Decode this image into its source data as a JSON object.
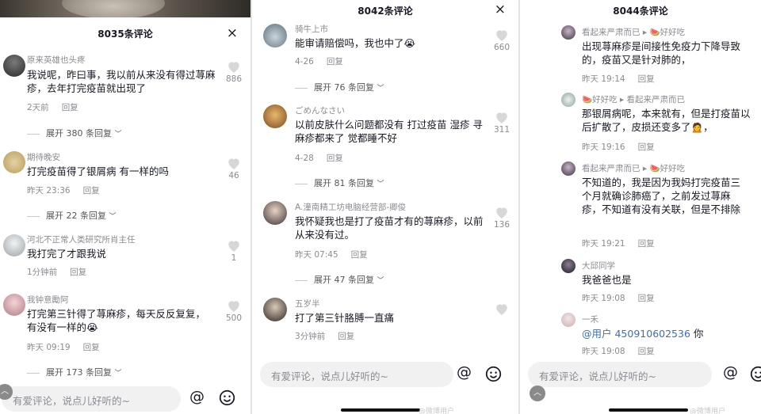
{
  "panels": [
    {
      "title": "8035条评论",
      "close": "×",
      "comments": [
        {
          "user": "原来英雄也头疼",
          "text": "我说呢，昨曰事，我以前从来没有得过荨麻疹，去年打完疫苗就出现了",
          "time": "2天前",
          "reply": "回复",
          "likes": "886",
          "expand": "展开 380 条回复"
        },
        {
          "user": "期待晚安",
          "text": "打完疫苗得了银屑病 有一样的吗",
          "time": "昨天 23:36",
          "reply": "回复",
          "likes": "46",
          "expand": "展开 22 条回复"
        },
        {
          "user": "河北不正常人类研究所肖主任",
          "text": "我打完了才跟我说",
          "time": "1分钟前",
          "reply": "回复",
          "likes": "1",
          "expand": ""
        },
        {
          "user": "我钟意勵阿",
          "text": "打完第三针得了荨麻疹，每天反反复复，有没有一样的😭",
          "time": "昨天 09:19",
          "reply": "回复",
          "likes": "500",
          "expand": "展开 173 条回复"
        }
      ],
      "input_placeholder": "有爱评论，说点儿好听的~"
    },
    {
      "title": "8042条评论",
      "close": "×",
      "comments": [
        {
          "user": "骑牛上市",
          "text": "能审请赔偿吗，我也中了😭",
          "time": "4-26",
          "reply": "回复",
          "likes": "660",
          "expand": "展开 76 条回复"
        },
        {
          "user": "ごめんなさい",
          "text": "以前皮肤什么问题都没有 打过疫苗 湿疹 寻麻疹都来了 觉都睡不好",
          "time": "4-28",
          "reply": "回复",
          "likes": "311",
          "expand": "展开 81 条回复"
        },
        {
          "user": "A.潼南精工坊电脑经营部-卿俊",
          "text": "我怀疑我也是打了疫苗才有的荨麻疹，以前从来没有过。",
          "time": "昨天 07:45",
          "reply": "回复",
          "likes": "136",
          "expand": "展开 47 条回复"
        },
        {
          "user": "五岁半",
          "text": "打了第三针胳膊一直痛",
          "time": "3分钟前",
          "reply": "回复",
          "likes": "",
          "expand": ""
        }
      ],
      "input_placeholder": "有爱评论，说点儿好听的~",
      "watermark": "@微博用户"
    },
    {
      "title": "8044条评论",
      "comments": [
        {
          "user": "看起来严肃而已",
          "arrow": "▸",
          "target": "🍉好好吃",
          "text": "出现荨麻疹是间接性免疫力下降导致的，疫苗又是针对肺的，",
          "time": "昨天 19:14",
          "reply": "回复"
        },
        {
          "user": "🍉好好吃",
          "arrow": "▸",
          "target": "看起来严肃而已",
          "text": "那银屑病呢，本来就有，但是打疫苗以后扩散了，皮损还变多了🙍，",
          "time": "昨天 19:16",
          "reply": "回复"
        },
        {
          "user": "看起来严肃而已",
          "arrow": "▸",
          "target": "🍉好好吃",
          "text": "不知道的，我是因为我妈打完疫苗三个月就确诊肺癌了，之前发过荨麻疹，不知道有没有关联，但是不排除",
          "time": "昨天 19:21",
          "reply": "回复"
        },
        {
          "user": "大邱同学",
          "text": "我爸爸也是",
          "time": "昨天 19:08",
          "reply": "回复"
        },
        {
          "user": "一禾",
          "mention": "@用户 450910602536",
          "text_after": " 你",
          "time": "昨天 19:08",
          "reply": "回复"
        }
      ],
      "input_placeholder": "有爱评论，说点儿好听的~",
      "watermark": "@微博用户"
    }
  ],
  "icons": {
    "at": "@",
    "emoji": "smiley-icon",
    "heart": "heart-icon",
    "scroll_top": "︿"
  },
  "colors": {
    "text": "#161823",
    "secondary": "#8a8b91",
    "mention": "#3b6fb6",
    "input_bg": "#f1f1f2"
  }
}
